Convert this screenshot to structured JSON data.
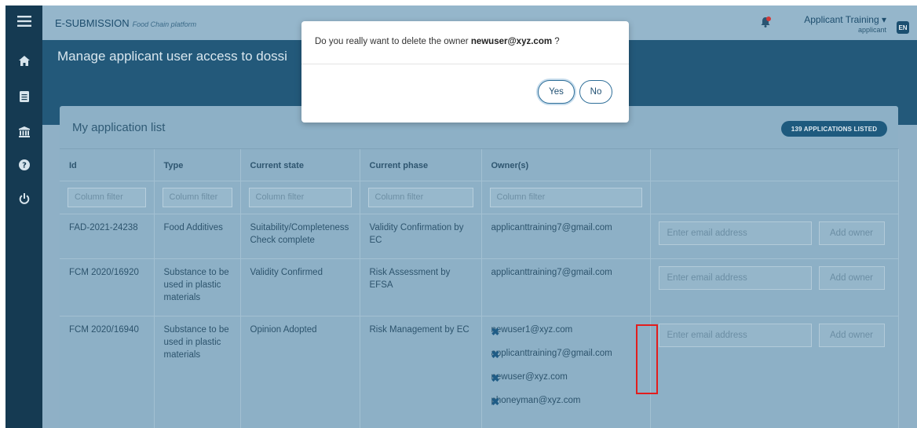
{
  "app": {
    "brand": "E-SUBMISSION",
    "brand_sub": "Food Chain platform",
    "user_name": "Applicant Training ▾",
    "user_role": "applicant",
    "language": "EN"
  },
  "sidebar": {
    "items": [
      {
        "name": "menu-icon"
      },
      {
        "name": "home-icon"
      },
      {
        "name": "document-icon"
      },
      {
        "name": "building-icon"
      },
      {
        "name": "help-icon"
      },
      {
        "name": "power-icon"
      }
    ]
  },
  "page": {
    "title": "Manage applicant user access to dossi"
  },
  "card": {
    "title": "My application list",
    "count_badge": "139 APPLICATIONS LISTED"
  },
  "table": {
    "columns": [
      "Id",
      "Type",
      "Current state",
      "Current phase",
      "Owner(s)",
      ""
    ],
    "filter_placeholder": "Column filter",
    "email_placeholder": "Enter email address",
    "add_owner_label": "Add owner",
    "remove_symbol": "✖",
    "rows": [
      {
        "id": "FAD-2021-24238",
        "type": "Food Additives",
        "state": "Suitability/Completeness Check complete",
        "phase": "Validity Confirmation by EC",
        "owners": [
          "applicanttraining7@gmail.com"
        ]
      },
      {
        "id": "FCM 2020/16920",
        "type": "Substance to be used in plastic materials",
        "state": "Validity Confirmed",
        "phase": "Risk Assessment by EFSA",
        "owners": [
          "applicanttraining7@gmail.com"
        ]
      },
      {
        "id": "FCM 2020/16940",
        "type": "Substance to be used in plastic materials",
        "state": "Opinion Adopted",
        "phase": "Risk Management by EC",
        "owners": [
          "newuser1@xyz.com",
          "applicanttraining7@gmail.com",
          "newuser@xyz.com",
          "phoneyman@xyz.com"
        ]
      }
    ]
  },
  "modal": {
    "message_prefix": "Do you really want to delete the owner ",
    "owner_email": "newuser@xyz.com",
    "message_suffix": " ?",
    "yes_label": "Yes",
    "no_label": "No"
  },
  "colors": {
    "sidebar": "#153a52",
    "banner": "#23597a",
    "overlay_bg": "#8fb0c6",
    "highlight": "#e21d1d"
  }
}
